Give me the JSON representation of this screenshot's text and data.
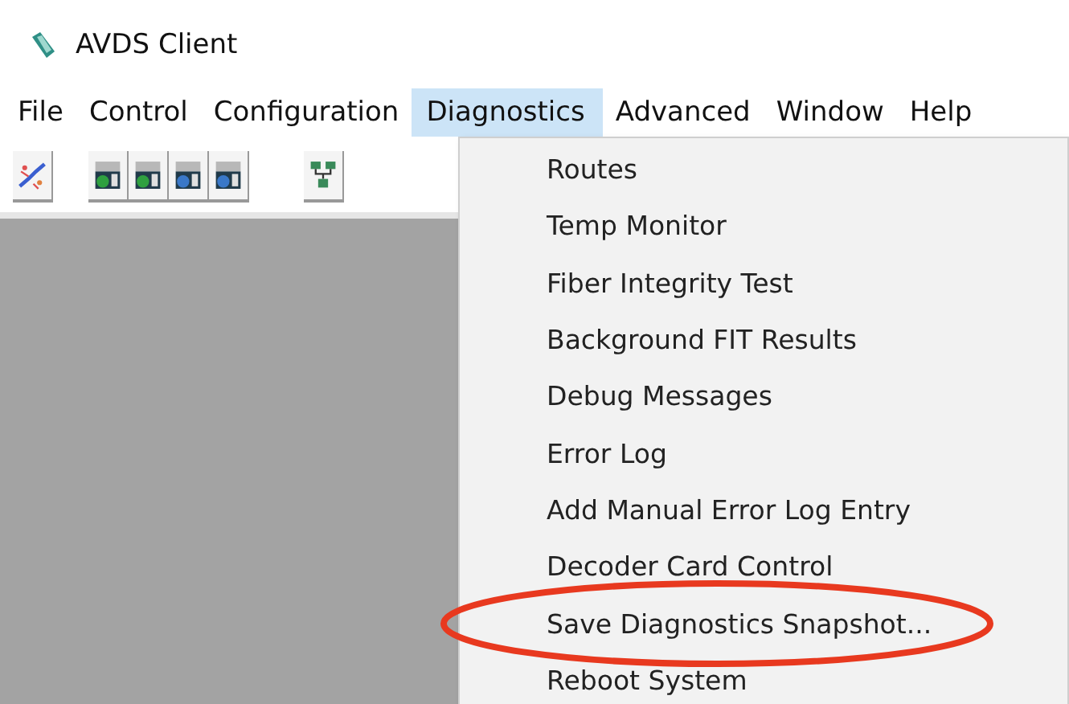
{
  "window": {
    "title": "AVDS Client"
  },
  "menu_bar": [
    {
      "label": "File",
      "selected": false
    },
    {
      "label": "Control",
      "selected": false
    },
    {
      "label": "Configuration",
      "selected": false
    },
    {
      "label": "Diagnostics",
      "selected": true
    },
    {
      "label": "Advanced",
      "selected": false
    },
    {
      "label": "Window",
      "selected": false
    },
    {
      "label": "Help",
      "selected": false
    }
  ],
  "toolbar": [
    {
      "kind": "plug"
    },
    {
      "kind": "disk-green"
    },
    {
      "kind": "disk-green"
    },
    {
      "kind": "disk-blue"
    },
    {
      "kind": "disk-blue"
    },
    {
      "kind": "network"
    }
  ],
  "dropdown": {
    "items": [
      {
        "label": "Routes",
        "circled": false
      },
      {
        "label": "Temp Monitor",
        "circled": false
      },
      {
        "label": "Fiber Integrity Test",
        "circled": false
      },
      {
        "label": "Background FIT Results",
        "circled": false
      },
      {
        "label": "Debug Messages",
        "circled": false
      },
      {
        "label": "Error Log",
        "circled": false
      },
      {
        "label": "Add Manual Error Log Entry",
        "circled": false
      },
      {
        "label": "Decoder Card Control",
        "circled": false
      },
      {
        "label": "Save Diagnostics Snapshot...",
        "circled": true
      },
      {
        "label": "Reboot System",
        "circled": false
      }
    ]
  }
}
